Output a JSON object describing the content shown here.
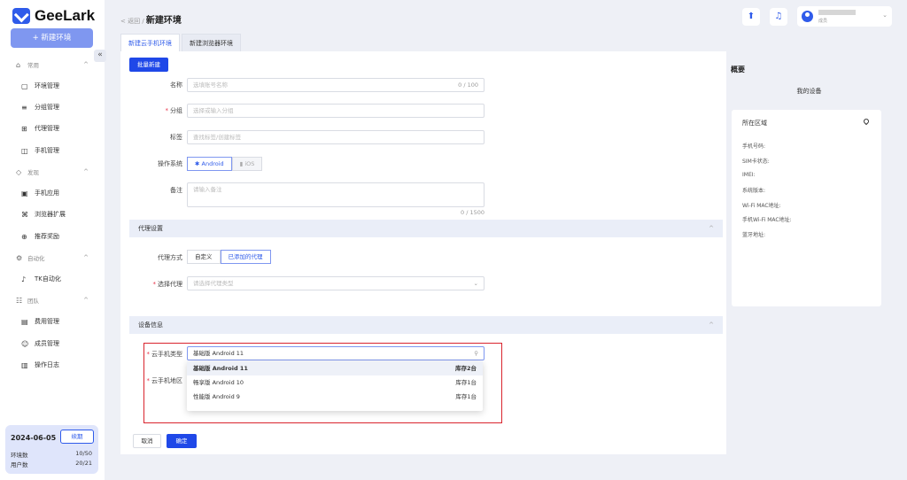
{
  "app": {
    "logo_text": "GeeLark",
    "new_env_label": "+ 新建环境",
    "collapse_glyph": "«"
  },
  "sidebar": {
    "groups": [
      {
        "label": "常用",
        "items": [
          "环境管理",
          "分组管理",
          "代理管理",
          "手机管理"
        ]
      },
      {
        "label": "发现",
        "items": [
          "手机应用",
          "浏览器扩展",
          "推荐奖励"
        ]
      },
      {
        "label": "自动化",
        "items": [
          "TK自动化"
        ]
      },
      {
        "label": "团队",
        "items": [
          "费用管理",
          "成员管理",
          "操作日志"
        ]
      }
    ],
    "stats": {
      "date": "2024-06-05",
      "renew_label": "续期",
      "env_label": "环境数",
      "env_value": "10/50",
      "user_label": "用户数",
      "user_value": "20/21"
    }
  },
  "header": {
    "back": "< 返回 / ",
    "title": "新建环境",
    "user_role": "成员"
  },
  "tabs": [
    {
      "label": "新建云手机环境"
    },
    {
      "label": "新建浏览器环境"
    }
  ],
  "form": {
    "batch_label": "批量新建",
    "name": {
      "label": "名称",
      "placeholder": "选填账号名称",
      "counter": "0 / 100"
    },
    "group": {
      "label": "分组",
      "placeholder": "选择或输入分组"
    },
    "tags": {
      "label": "标签",
      "placeholder": "查找标签/创建标签"
    },
    "os": {
      "label": "操作系统",
      "android": "Android",
      "ios": "iOS"
    },
    "note": {
      "label": "备注",
      "placeholder": "请输入备注",
      "counter": "0 / 1500"
    },
    "proxy_section": "代理设置",
    "proxy_mode": {
      "label": "代理方式",
      "custom": "自定义",
      "added": "已添加的代理"
    },
    "proxy_select": {
      "label": "选择代理",
      "placeholder": "请选择代理类型"
    },
    "device_section": "设备信息",
    "phone_type": {
      "label": "云手机类型",
      "value": "基础版 Android 11"
    },
    "phone_region": {
      "label": "云手机地区"
    },
    "options": [
      {
        "name": "基础版 Android 11",
        "stock": "库存2台"
      },
      {
        "name": "畅享版 Android 10",
        "stock": "库存1台"
      },
      {
        "name": "性能版 Android 9",
        "stock": "库存1台"
      }
    ],
    "cancel_label": "取消",
    "ok_label": "确定"
  },
  "overview": {
    "title": "概要",
    "my_device": "我的设备",
    "region_label": "所在区域",
    "specs": [
      "手机号码:",
      "SIM卡状态:",
      "IMEI:",
      "系统版本:",
      "Wi-Fi MAC地址:",
      "手机Wi-Fi MAC地址:",
      "蓝牙地址:"
    ]
  },
  "colors": {
    "accent": "#1f48e8",
    "highlight": "#d9242e"
  }
}
